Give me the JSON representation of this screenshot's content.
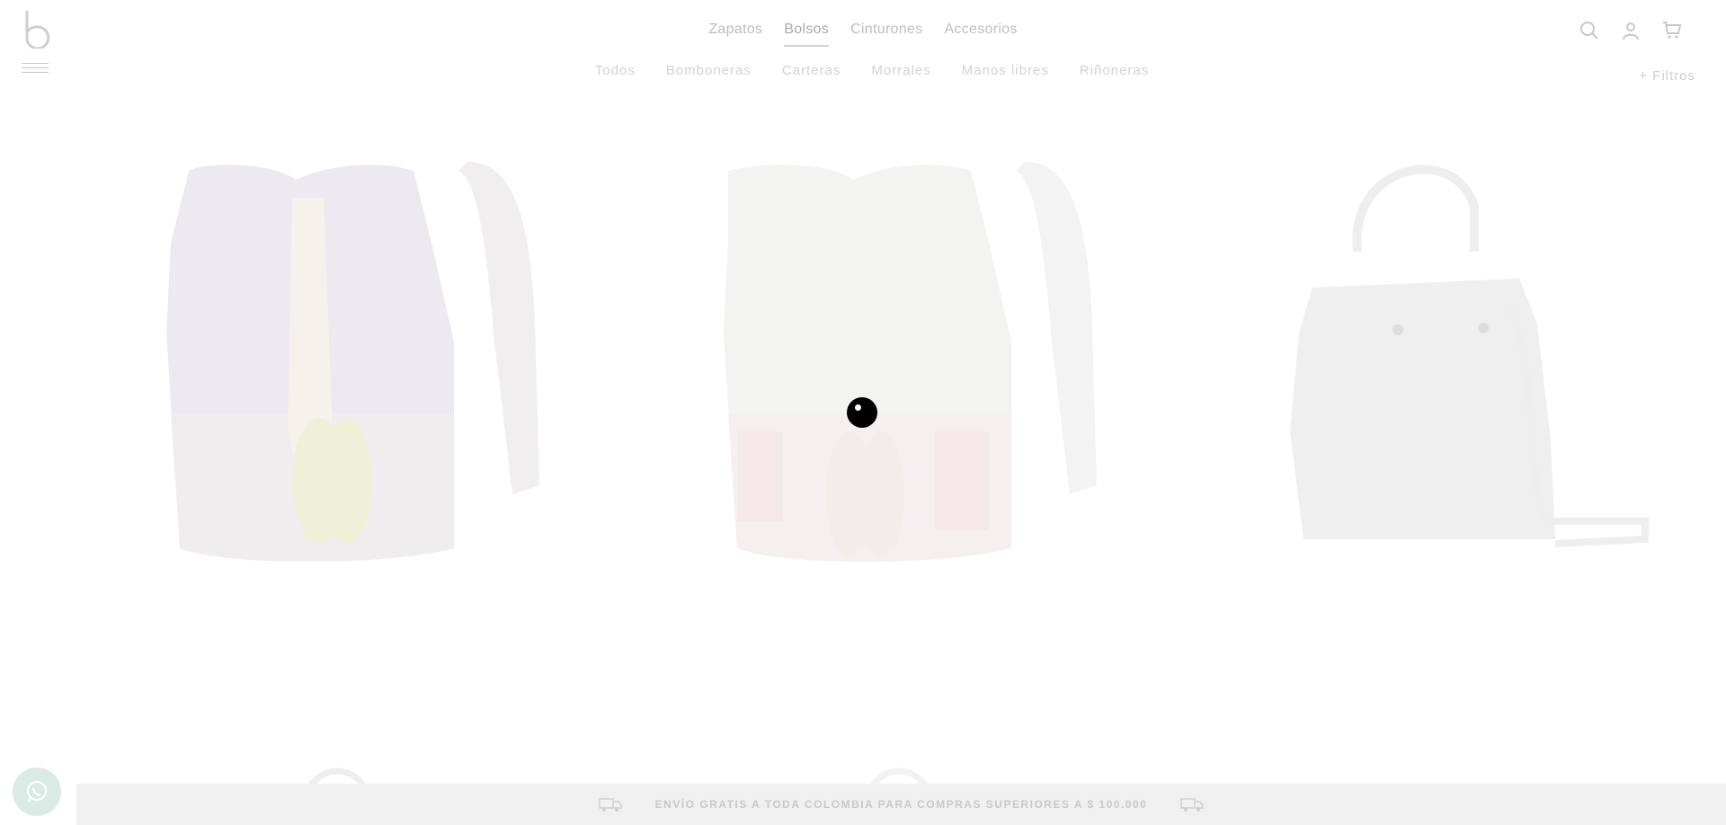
{
  "header": {
    "top_nav": [
      {
        "label": "Zapatos",
        "active": false
      },
      {
        "label": "Bolsos",
        "active": true
      },
      {
        "label": "Cinturones",
        "active": false
      },
      {
        "label": "Accesorios",
        "active": false
      }
    ],
    "sub_nav": [
      "Todos",
      "Bomboneras",
      "Carteras",
      "Morrales",
      "Manos libres",
      "Riñoneras"
    ],
    "filters_label": "+ Filtros",
    "icons": [
      "search-icon",
      "user-icon",
      "cart-icon",
      "menu-icon"
    ]
  },
  "products": [
    {
      "name": "bucket-bag-cream-embroidered",
      "color": "#e8e4f0"
    },
    {
      "name": "bucket-bag-white-red-pattern",
      "color": "#f2f0ee"
    },
    {
      "name": "bucket-bag-grey",
      "color": "#ededed"
    }
  ],
  "banner": {
    "text": "ENVÍO GRATIS A TODA COLOMBIA PARA COMPRAS SUPERIORES A $ 100.000"
  },
  "colors": {
    "background": "#ffffff",
    "banner_bg": "#f0f0f0",
    "loader": "#000000"
  }
}
